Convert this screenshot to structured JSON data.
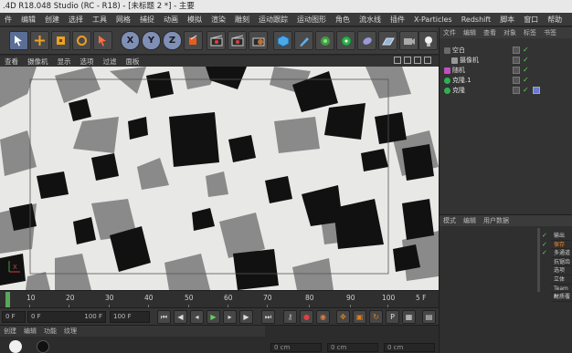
{
  "titlebar": {
    "title": ".4D R18.048 Studio (RC - R18) - [未标题 2 *] - 主要"
  },
  "menu": [
    "件",
    "编辑",
    "创建",
    "选择",
    "工具",
    "网格",
    "捕捉",
    "动画",
    "模拟",
    "渲染",
    "雕刻",
    "运动跟踪",
    "运动图形",
    "角色",
    "流水线",
    "插件",
    "X-Particles",
    "Redshift",
    "脚本",
    "窗口",
    "帮助"
  ],
  "toolbar": {
    "axis_x": "X",
    "axis_y": "Y",
    "axis_z": "Z"
  },
  "viewport_menu": [
    "查看",
    "摄像机",
    "显示",
    "选项",
    "过滤",
    "面板"
  ],
  "object_manager": {
    "tabs": [
      "文件",
      "编辑",
      "查看",
      "对象",
      "标签",
      "书签"
    ],
    "objects": [
      {
        "name": "空白"
      },
      {
        "name": "摄像机"
      },
      {
        "name": "随机"
      },
      {
        "name": "克隆.1"
      },
      {
        "name": "克隆"
      }
    ]
  },
  "attributes": {
    "tabs": [
      "模式",
      "编辑",
      "用户数据"
    ],
    "side_tabs": [
      "输出",
      "保存",
      "多通道",
      "抗锯齿",
      "选项",
      "立体",
      "Team R",
      "材质覆"
    ],
    "active_side_tab": "保存"
  },
  "timeline": {
    "ticks": [
      "10",
      "20",
      "30",
      "40",
      "50",
      "60",
      "70",
      "80",
      "90",
      "100"
    ],
    "end_frame_label": "5 F"
  },
  "transport": {
    "current_frame": "0 F",
    "start_frame": "0 F",
    "end_frame": "100 F",
    "max_frame": "100 F"
  },
  "material_manager": {
    "tabs": [
      "创建",
      "编辑",
      "功能",
      "纹理"
    ]
  },
  "coords": {
    "x": "0 cm",
    "y": "0 cm",
    "z": "0 cm"
  },
  "viewport_axis_label": "X",
  "colors": {
    "viewport_bg": "#e8e9e6",
    "accent": "#f28a2a",
    "active_tab": "#f28a2a"
  }
}
